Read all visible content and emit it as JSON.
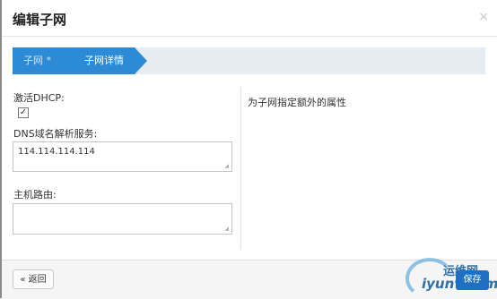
{
  "modal": {
    "title": "编辑子网",
    "close_icon": "×"
  },
  "wizard": {
    "steps": [
      {
        "label": "子网 *",
        "state": "done"
      },
      {
        "label": "子网详情",
        "state": "active"
      }
    ]
  },
  "form": {
    "dhcp": {
      "label": "激活DHCP:",
      "checked": true,
      "check_glyph": "✓"
    },
    "dns": {
      "label": "DNS域名解析服务:",
      "value": "114.114.114.114"
    },
    "host_routes": {
      "label": "主机路由:",
      "value": ""
    },
    "help_text": "为子网指定额外的属性"
  },
  "footer": {
    "back_label": "« 返回",
    "save_label": "保存"
  },
  "watermark": {
    "line1": "运维网",
    "line2": "iyunv.com"
  },
  "colors": {
    "accent": "#2d8bd6",
    "primary_button": "#1f6fc2",
    "wizard_bg": "#e6edf2"
  }
}
